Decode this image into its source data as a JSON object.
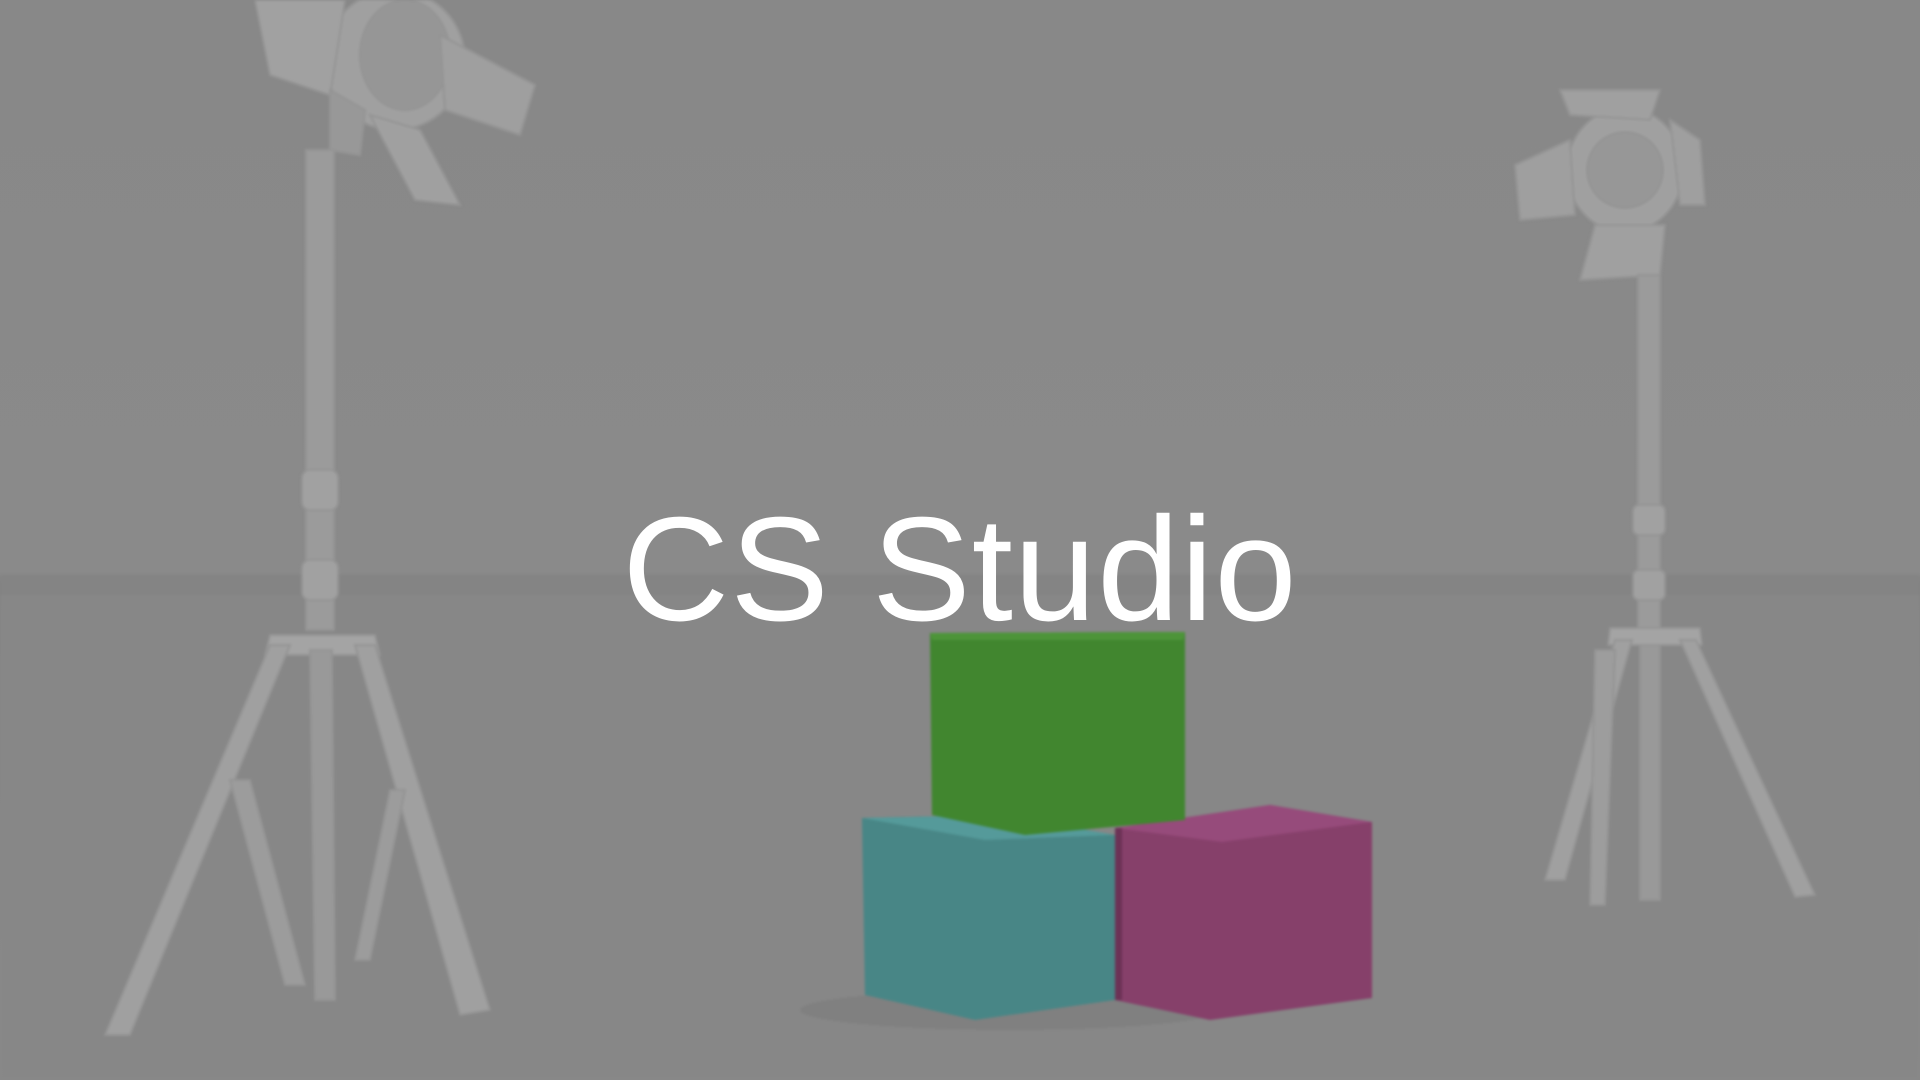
{
  "splash": {
    "title": "CS Studio"
  },
  "scene": {
    "background_color": "#8e8e8e",
    "cube_colors": {
      "green": "#3f8a2c",
      "teal": "#478a8a",
      "magenta": "#8a3e6c"
    },
    "icons": [
      "studio-light-left-icon",
      "studio-light-right-icon"
    ]
  }
}
